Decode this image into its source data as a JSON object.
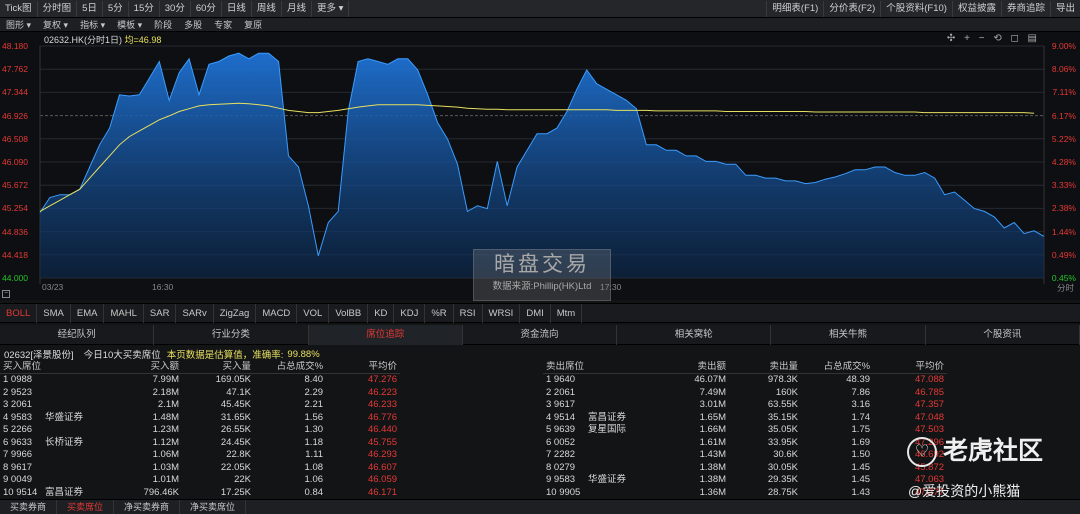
{
  "toolbar_main": {
    "left": [
      "Tick图",
      "分时图",
      "5日",
      "5分",
      "15分",
      "30分",
      "60分",
      "日线",
      "周线",
      "月线",
      "更多 ▾"
    ],
    "right": [
      "明细表(F1)",
      "分价表(F2)",
      "个股资料(F10)",
      "权益披露",
      "券商追踪",
      "导出"
    ]
  },
  "toolbar_sub": [
    "图形 ▾",
    "复权 ▾",
    "指标 ▾",
    "模板 ▾",
    "阶段",
    "多股",
    "专家",
    "复原"
  ],
  "chart": {
    "title": "02632.HK(分时1日)",
    "avg_label": "均=46.98",
    "tools": "✣ + − ⟲ ◻ ▤",
    "y_left": [
      "48.180",
      "47.762",
      "47.344",
      "46.926",
      "46.508",
      "46.090",
      "45.672",
      "45.254",
      "44.836",
      "44.418",
      "44.000"
    ],
    "y_right": [
      "9.00%",
      "8.06%",
      "7.11%",
      "6.17%",
      "5.22%",
      "4.28%",
      "3.33%",
      "2.38%",
      "1.44%",
      "0.49%",
      "0.45%"
    ],
    "x_labels": [
      "03/23",
      "16:30",
      "17:30"
    ],
    "right_bottom": "分时",
    "minus": "−",
    "ylim": [
      44.0,
      48.18
    ],
    "price": [
      45.18,
      45.45,
      45.5,
      45.5,
      45.6,
      46.0,
      46.4,
      46.7,
      47.3,
      47.28,
      47.3,
      47.6,
      47.9,
      47.2,
      47.7,
      47.95,
      47.3,
      47.85,
      47.9,
      48.0,
      48.05,
      47.95,
      48.05,
      48.05,
      47.9,
      46.2,
      46.0,
      45.3,
      44.4,
      45.0,
      45.2,
      47.0,
      47.9,
      47.95,
      47.9,
      47.85,
      47.95,
      47.95,
      47.75,
      47.3,
      46.8,
      46.5,
      46.05,
      45.2,
      45.3,
      45.25,
      46.1,
      45.3,
      46.0,
      46.3,
      46.6,
      46.6,
      46.7,
      47.0,
      47.4,
      47.75,
      47.5,
      47.4,
      47.3,
      47.2,
      47.05,
      46.4,
      46.4,
      46.3,
      46.3,
      46.2,
      46.2,
      46.1,
      46.1,
      46.05,
      46.05,
      45.85,
      45.85,
      45.8,
      45.8,
      45.75,
      45.75,
      45.7,
      45.72,
      45.78,
      45.82,
      45.88,
      45.95,
      45.95,
      46.0,
      46.0,
      45.9,
      45.85,
      45.85,
      45.9,
      45.8,
      45.5,
      45.55,
      45.4,
      45.25,
      45.2,
      45.1,
      44.9,
      45.0,
      44.8,
      44.85,
      44.75
    ],
    "avg": [
      45.2,
      45.3,
      45.4,
      45.5,
      45.6,
      45.8,
      46.0,
      46.2,
      46.4,
      46.55,
      46.65,
      46.75,
      46.85,
      46.92,
      47.0,
      47.05,
      47.1,
      47.12,
      47.13,
      47.14,
      47.15,
      47.14,
      47.12,
      47.1,
      47.06,
      47.02,
      47.0,
      46.98,
      46.98,
      47.0,
      47.02,
      47.05,
      47.08,
      47.1,
      47.12,
      47.12,
      47.12,
      47.12,
      47.12,
      47.11,
      47.1,
      47.09,
      47.08,
      47.06,
      47.05,
      47.04,
      47.04,
      47.03,
      47.03,
      47.03,
      47.03,
      47.03,
      47.03,
      47.03,
      47.03,
      47.03,
      47.03,
      47.03,
      47.02,
      47.02,
      47.02,
      47.02,
      47.01,
      47.01,
      47.01,
      47.01,
      47.01,
      47.01,
      47.01,
      47.0,
      47.0,
      47.0,
      47.0,
      47.0,
      47.0,
      47.0,
      47.0,
      47.0,
      46.99,
      46.99,
      46.99,
      46.99,
      46.99,
      46.99,
      46.99,
      46.99,
      46.99,
      46.99,
      46.99,
      46.98,
      46.98,
      46.98,
      46.98,
      46.98,
      46.98,
      46.98,
      46.98,
      46.98,
      46.98,
      46.98,
      46.97
    ]
  },
  "watermark": {
    "title": "暗盘交易",
    "source": "数据来源:Phillip(HK)Ltd"
  },
  "indicators": [
    "BOLL",
    "SMA",
    "EMA",
    "MAHL",
    "SAR",
    "SARv",
    "ZigZag",
    "MACD",
    "VOL",
    "VolBB",
    "KD",
    "KDJ",
    "%R",
    "RSI",
    "WRSI",
    "DMI",
    "Mtm"
  ],
  "tabs": [
    "经纪队列",
    "行业分类",
    "席位追踪",
    "资金流向",
    "相关窝轮",
    "相关牛熊",
    "个股资讯"
  ],
  "info": {
    "left": "02632[泽景股份]",
    "mid": "今日10大买卖席位",
    "note": "本页数据是估算值，准确率:",
    "acc": "99.88%"
  },
  "buy": {
    "headers": [
      "买入席位",
      "买入额",
      "买入量",
      "占总成交%",
      "平均价"
    ],
    "rows": [
      [
        "1  0988",
        "",
        "7.99M",
        "169.05K",
        "8.40",
        "47.276"
      ],
      [
        "2  9523",
        "",
        "2.18M",
        "47.1K",
        "2.29",
        "46.223"
      ],
      [
        "3  2061",
        "",
        "2.1M",
        "45.45K",
        "2.21",
        "46.233"
      ],
      [
        "4  9583",
        "华盛证券",
        "1.48M",
        "31.65K",
        "1.56",
        "46.776"
      ],
      [
        "5  2266",
        "",
        "1.23M",
        "26.55K",
        "1.30",
        "46.440"
      ],
      [
        "6  9633",
        "长桥证券",
        "1.12M",
        "24.45K",
        "1.18",
        "45.755"
      ],
      [
        "7  9966",
        "",
        "1.06M",
        "22.8K",
        "1.11",
        "46.293"
      ],
      [
        "8  9617",
        "",
        "1.03M",
        "22.05K",
        "1.08",
        "46.607"
      ],
      [
        "9  0049",
        "",
        "1.01M",
        "22K",
        "1.06",
        "46.059"
      ],
      [
        "10  9514",
        "富昌证券",
        "796.46K",
        "17.25K",
        "0.84",
        "46.171"
      ]
    ]
  },
  "sell": {
    "headers": [
      "卖出席位",
      "卖出额",
      "卖出量",
      "占总成交%",
      "平均价"
    ],
    "rows": [
      [
        "1  9640",
        "",
        "46.07M",
        "978.3K",
        "48.39",
        "47.088"
      ],
      [
        "2  2061",
        "",
        "7.49M",
        "160K",
        "7.86",
        "46.785"
      ],
      [
        "3  9617",
        "",
        "3.01M",
        "63.55K",
        "3.16",
        "47.357"
      ],
      [
        "4  9514",
        "富昌证券",
        "1.65M",
        "35.15K",
        "1.74",
        "47.048"
      ],
      [
        "5  9639",
        "复星国际",
        "1.66M",
        "35.05K",
        "1.75",
        "47.503"
      ],
      [
        "6  0052",
        "",
        "1.61M",
        "33.95K",
        "1.69",
        "47.296"
      ],
      [
        "7  2282",
        "",
        "1.43M",
        "30.6K",
        "1.50",
        "46.692"
      ],
      [
        "8  0279",
        "",
        "1.38M",
        "30.05K",
        "1.45",
        "45.872"
      ],
      [
        "9  9583",
        "华盛证券",
        "1.38M",
        "29.35K",
        "1.45",
        "47.063"
      ],
      [
        "10  9905",
        "",
        "1.36M",
        "28.75K",
        "1.43",
        "47.277"
      ]
    ]
  },
  "bottom_tabs": [
    "买卖券商",
    "买卖席位",
    "净买卖券商",
    "净买卖席位"
  ],
  "watermark2": {
    "brand": "老虎社区",
    "author": "@爱投资的小熊猫"
  },
  "colors": {
    "up": "#e53935",
    "down": "#27c327",
    "line": "#e8e060",
    "area": "#1f73d6"
  }
}
